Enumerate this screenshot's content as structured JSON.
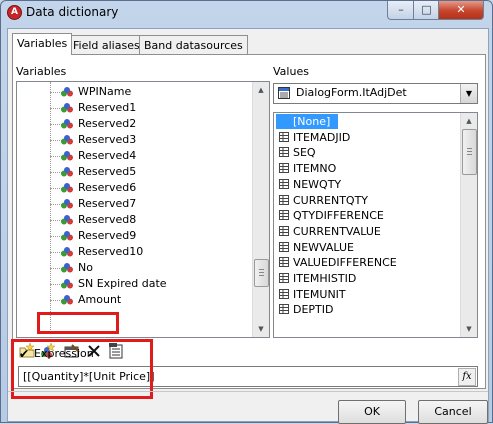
{
  "window": {
    "title": "Data dictionary",
    "app_icon_glyph": "A"
  },
  "caption_buttons": {
    "minimize": "–",
    "maximize": "□",
    "close": "✕"
  },
  "tabs": [
    {
      "label": "Variables"
    },
    {
      "label": "Field aliases"
    },
    {
      "label": "Band datasources"
    }
  ],
  "variables": {
    "label": "Variables",
    "items": [
      "WPIName",
      "Reserved1",
      "Reserved2",
      "Reserved3",
      "Reserved4",
      "Reserved5",
      "Reserved6",
      "Reserved7",
      "Reserved8",
      "Reserved9",
      "Reserved10",
      "No",
      "SN Expired date",
      "Amount"
    ]
  },
  "values": {
    "label": "Values",
    "combo_value": "DialogForm.ItAdjDet",
    "items": [
      "[None]",
      "ITEMADJID",
      "SEQ",
      "ITEMNO",
      "NEWQTY",
      "CURRENTQTY",
      "QTYDIFFERENCE",
      "CURRENTVALUE",
      "NEWVALUE",
      "VALUEDIFFERENCE",
      "ITEMHISTID",
      "ITEMUNIT",
      "DEPTID"
    ]
  },
  "toolbar": [
    "new-category-icon",
    "new-variable-icon",
    "edit-icon",
    "delete-icon",
    "edit-list-icon"
  ],
  "expression": {
    "checkbox_checked": true,
    "checkbox_label": "Expression",
    "value": "[[Quantity]*[Unit Price]]",
    "fx_label": "fx"
  },
  "buttons": {
    "ok": "OK",
    "cancel": "Cancel"
  },
  "colors": {
    "highlight": "#e01b1b",
    "selection": "#3399ff",
    "title_bar": "#c3d5ea"
  }
}
